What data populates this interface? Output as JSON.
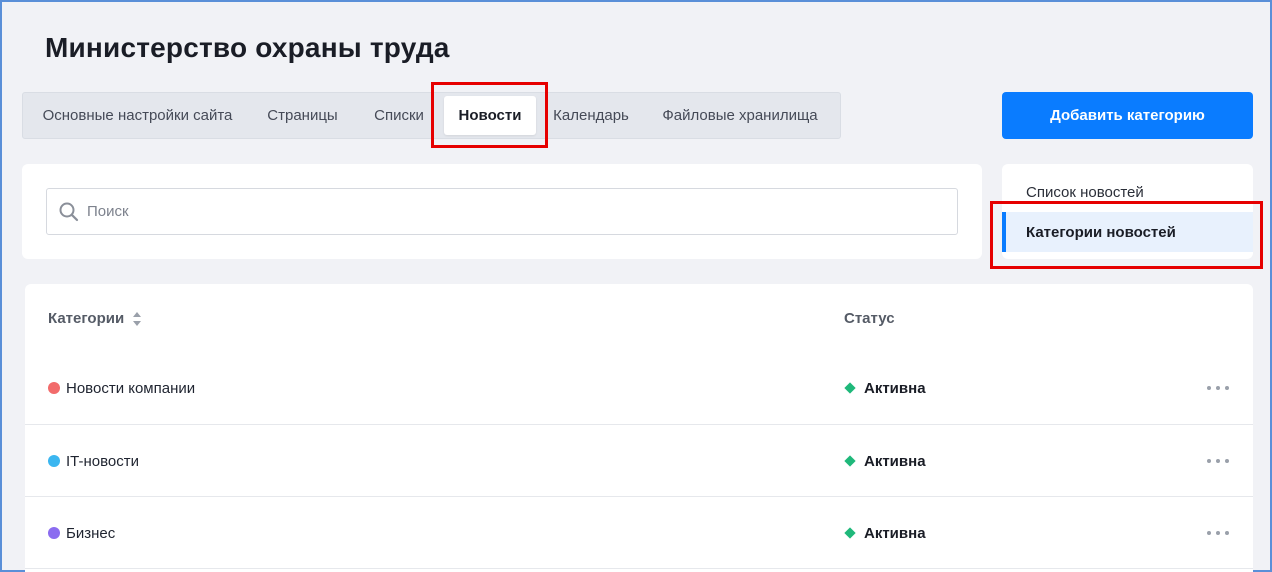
{
  "header": {
    "title": "Министерство охраны труда"
  },
  "tabs": [
    {
      "label": "Основные настройки сайта",
      "active": false
    },
    {
      "label": "Страницы",
      "active": false
    },
    {
      "label": "Списки",
      "active": false
    },
    {
      "label": "Новости",
      "active": true
    },
    {
      "label": "Календарь",
      "active": false
    },
    {
      "label": "Файловые хранилища",
      "active": false
    }
  ],
  "actions": {
    "add_category_label": "Добавить категорию"
  },
  "search": {
    "placeholder": "Поиск",
    "value": "",
    "icon": "search-icon"
  },
  "side_menu": {
    "items": [
      {
        "label": "Список новостей",
        "active": false
      },
      {
        "label": "Категории новостей",
        "active": true
      }
    ]
  },
  "table": {
    "columns": {
      "category": "Категории",
      "status": "Статус"
    },
    "rows": [
      {
        "name": "Новости компании",
        "color": "#f26b6b",
        "status": "Активна"
      },
      {
        "name": "IT-новости",
        "color": "#3bb6f0",
        "status": "Активна"
      },
      {
        "name": "Бизнес",
        "color": "#8b6cf0",
        "status": "Активна"
      }
    ]
  },
  "colors": {
    "accent": "#0a7cff",
    "status_active": "#1fb87a",
    "highlight": "#e60000"
  }
}
